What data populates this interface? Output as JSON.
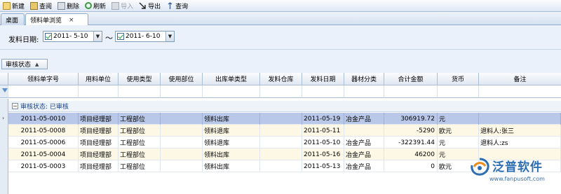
{
  "toolbar": {
    "items": [
      {
        "label": "新建",
        "icon": "new-document-icon",
        "enabled": true
      },
      {
        "label": "查阅",
        "icon": "view-folder-icon",
        "enabled": true
      },
      {
        "label": "删除",
        "icon": "delete-icon",
        "enabled": true
      },
      {
        "label": "刷新",
        "icon": "refresh-icon",
        "enabled": true
      },
      {
        "label": "导入",
        "icon": "import-icon",
        "enabled": false
      },
      {
        "label": "导出",
        "icon": "export-icon",
        "enabled": true
      },
      {
        "label": "查询",
        "icon": "query-icon",
        "enabled": true
      }
    ]
  },
  "tabs": {
    "desktop": "桌面",
    "browse": "领料单浏览",
    "close": "×"
  },
  "filter": {
    "label": "发料日期:",
    "from": "2011- 5-10",
    "to": "2011- 6-10",
    "separator": "～"
  },
  "group_panel": {
    "chip": "审核状态",
    "sort_arrow": "▲"
  },
  "grid": {
    "columns": [
      "领料单字号",
      "用料单位",
      "使用类型",
      "使用部位",
      "出库单类型",
      "发料仓库",
      "发料日期",
      "器材分类",
      "合计金额",
      "货币",
      "备注"
    ],
    "group_row": "审核状态: 已审核",
    "rows": [
      [
        "2011-05-0010",
        "项目经理部",
        "工程部位",
        "",
        "领料出库",
        "",
        "2011-05-19",
        "冶金产品",
        "306919.72",
        "元",
        ""
      ],
      [
        "2011-05-0008",
        "项目经理部",
        "工程部位",
        "",
        "领料退库",
        "",
        "2011-05-11",
        "",
        "-5290",
        "欧元",
        "退料人:张三"
      ],
      [
        "2011-05-0006",
        "项目经理部",
        "工程部位",
        "",
        "领料退库",
        "",
        "2011-05-10",
        "冶金产品",
        "-322391.44",
        "元",
        "退料人:zs"
      ],
      [
        "2011-05-0004",
        "项目经理部",
        "工程部位",
        "",
        "领料出库",
        "",
        "2011-05-16",
        "冶金产品",
        "46200",
        "元",
        ""
      ],
      [
        "2011-05-0003",
        "项目经理部",
        "工程部位",
        "",
        "领料出库",
        "",
        "2011-05-13",
        "冶金产品",
        "0",
        "欧元",
        ""
      ]
    ],
    "selected_row": 0
  },
  "logo": {
    "text": "泛普软件",
    "url": "www.fanpusoft.com"
  },
  "colors": {
    "selected_row": "#b9c8e8",
    "alt_row": "#fdf8e6",
    "group_text": "#15428b"
  }
}
